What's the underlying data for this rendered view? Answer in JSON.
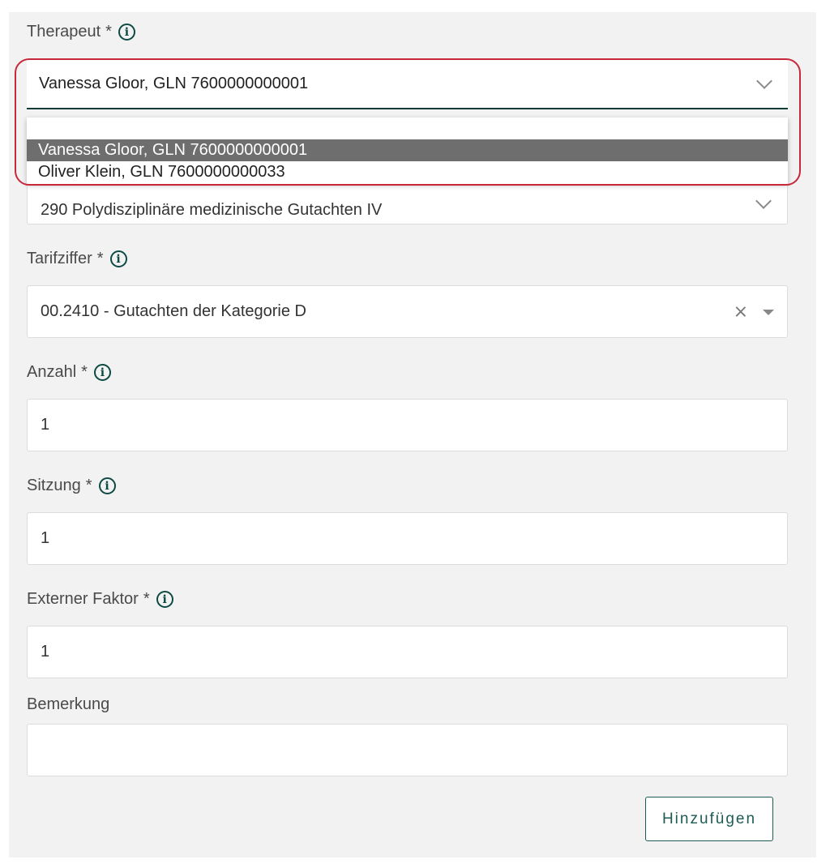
{
  "fields": {
    "therapeut": {
      "label": "Therapeut",
      "required_mark": "*",
      "value": "Vanessa Gloor, GLN 7600000000001",
      "options": [
        "Vanessa Gloor, GLN 7600000000001",
        "Oliver Klein, GLN 7600000000033"
      ],
      "selected_option": "Vanessa Gloor, GLN 7600000000001"
    },
    "leistung": {
      "value": "290 Polydisziplinäre medizinische Gutachten IV"
    },
    "tarifziffer": {
      "label": "Tarifziffer",
      "required_mark": "*",
      "value": "00.2410 - Gutachten der Kategorie D",
      "clear_symbol": "×"
    },
    "anzahl": {
      "label": "Anzahl",
      "required_mark": "*",
      "value": "1"
    },
    "sitzung": {
      "label": "Sitzung",
      "required_mark": "*",
      "value": "1"
    },
    "externer_faktor": {
      "label": "Externer Faktor",
      "required_mark": "*",
      "value": "1"
    },
    "bemerkung": {
      "label": "Bemerkung",
      "value": ""
    }
  },
  "info_icon_glyph": "i",
  "submit_button": {
    "label": "Hinzufügen"
  },
  "colors": {
    "accent": "#0e4a44",
    "highlight_outline": "#c8283a",
    "selected_option_bg": "#6e6e6e",
    "panel_bg": "#f2f2f2"
  }
}
